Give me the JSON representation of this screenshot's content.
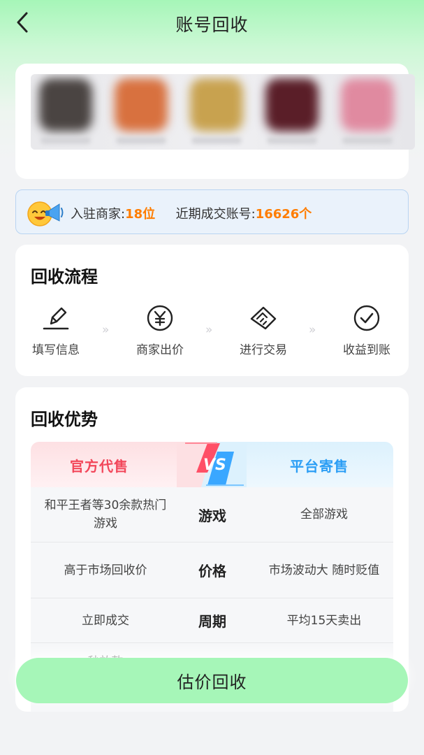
{
  "header": {
    "title": "账号回收",
    "back_icon": "chevron-left-icon"
  },
  "games": {
    "icon_colors": [
      "#4a4442",
      "#d8713f",
      "#c8a24f",
      "#5a1e28",
      "#e08aa0"
    ]
  },
  "stats": {
    "merchants_label": "入驻商家:",
    "merchants_value": "18位",
    "deals_label": "近期成交账号:",
    "deals_value": "16626个",
    "mascot_icon": "megaphone-mascot-icon",
    "highlight_color": "#ff7d00"
  },
  "flow": {
    "title": "回收流程",
    "steps": [
      {
        "label": "填写信息",
        "icon": "pencil-icon"
      },
      {
        "label": "商家出价",
        "icon": "yen-coin-icon"
      },
      {
        "label": "进行交易",
        "icon": "handshake-icon"
      },
      {
        "label": "收益到账",
        "icon": "check-circle-icon"
      }
    ],
    "separator": "»"
  },
  "advantages": {
    "title": "回收优势",
    "left_header": "官方代售",
    "right_header": "平台寄售",
    "vs_label": "VS",
    "rows": [
      {
        "left": "和平王者等30余款热门游戏",
        "mid": "游戏",
        "right": "全部游戏"
      },
      {
        "left": "高于市场回收价",
        "mid": "价格",
        "right": "市场波动大 随时贬值"
      },
      {
        "left": "立即成交",
        "mid": "周期",
        "right": "平均15天卖出"
      },
      {
        "left": "秒放款",
        "mid": "",
        "right": ""
      }
    ],
    "left_color": "#f2475a",
    "right_color": "#2c9ef5"
  },
  "cta": {
    "label": "估价回收",
    "color": "#a6f6b8"
  }
}
